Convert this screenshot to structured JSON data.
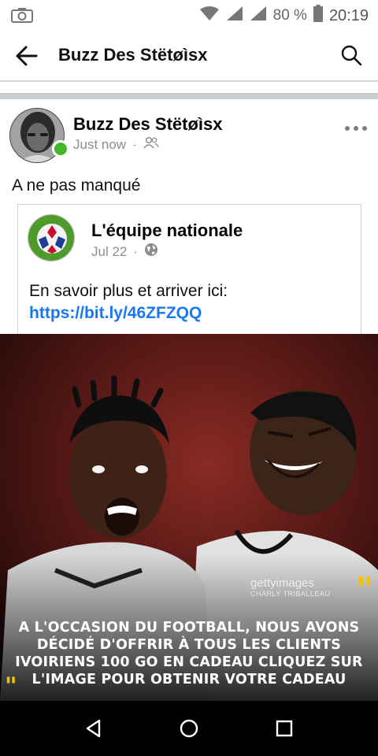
{
  "status_bar": {
    "camera_icon": "camera-icon",
    "wifi_icon": "wifi-icon",
    "signal_icon": "signal-icon",
    "battery_percent": "80 %",
    "battery_icon": "battery-icon",
    "time": "20:19"
  },
  "header": {
    "title": "Buzz Des Stëtøìsx"
  },
  "post": {
    "author": "Buzz Des Stëtøìsx",
    "timestamp": "Just now",
    "audience_icon": "friends-icon",
    "text": "A ne pas manqué",
    "shared": {
      "page_name": "L'équipe nationale",
      "date": "Jul 22",
      "audience_icon": "globe-icon",
      "text_prefix": "En savoir plus et arriver ici: ",
      "link": "https://bit.ly/46ZFZQQ"
    },
    "image": {
      "watermark": "gettyimages",
      "watermark_credit": "CHARLY TRIBALLEAU",
      "caption": "A L'OCCASION DU FOOTBALL, NOUS AVONS DÉCIDÉ D'OFFRIR À TOUS LES CLIENTS IVOIRIENS 100 GO EN CADEAU CLIQUEZ SUR L'IMAGE POUR OBTENIR VOTRE CADEAU"
    }
  },
  "colors": {
    "link": "#1877f2",
    "online": "#42b72a",
    "quote": "#f2c200"
  }
}
